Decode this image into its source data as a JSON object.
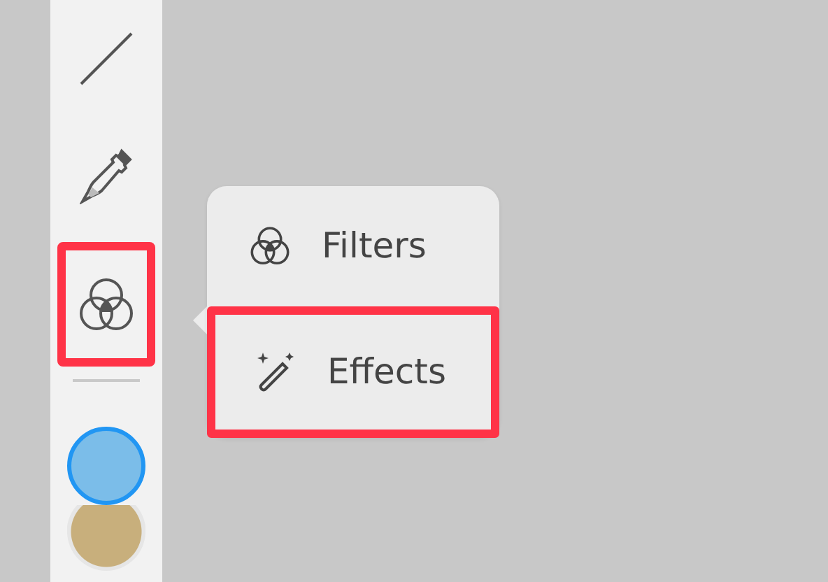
{
  "toolbar": {
    "tools": [
      {
        "kind": "line",
        "highlighted": false
      },
      {
        "kind": "eyedropper",
        "highlighted": false
      },
      {
        "kind": "filters",
        "highlighted": true
      }
    ],
    "swatches": [
      {
        "color": "#7bbde9",
        "selected": true
      },
      {
        "color": "#c8af7c",
        "selected": false
      }
    ]
  },
  "menu": {
    "items": [
      {
        "kind": "filters",
        "label": "Filters",
        "highlighted": false
      },
      {
        "kind": "effects",
        "label": "Effects",
        "highlighted": true
      }
    ]
  }
}
